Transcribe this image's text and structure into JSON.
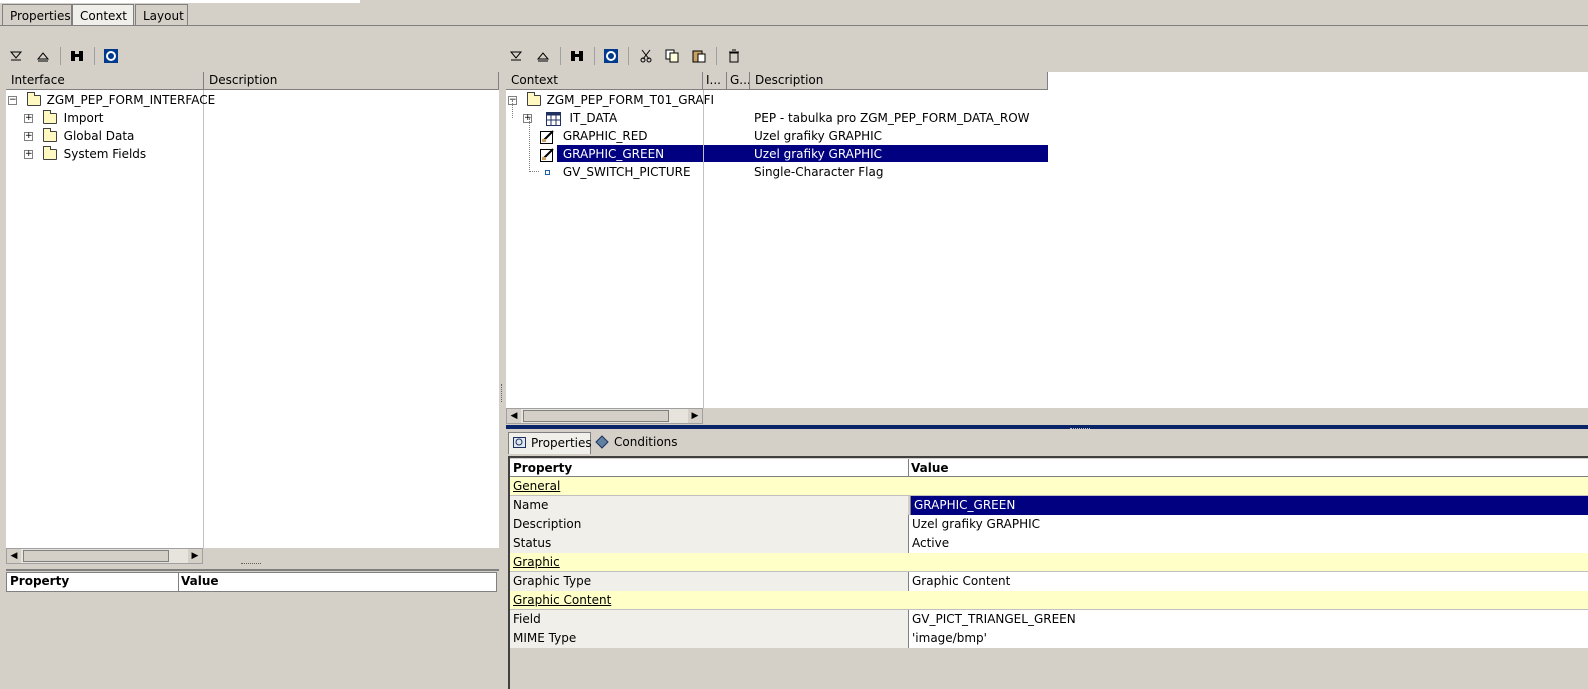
{
  "top_tabs": [
    {
      "label": "Properties",
      "active": false
    },
    {
      "label": "Context",
      "active": true
    },
    {
      "label": "Layout",
      "active": false
    }
  ],
  "left_toolbar": {
    "icons": [
      "expand-all-icon",
      "collapse-all-icon",
      "find-icon",
      "refresh-icon"
    ]
  },
  "right_toolbar": {
    "icons": [
      "expand-all-icon",
      "collapse-all-icon",
      "find-icon",
      "refresh-icon",
      "cut-icon",
      "copy-icon",
      "paste-icon",
      "delete-icon"
    ]
  },
  "interface_tree": {
    "headers": {
      "interface": "Interface",
      "description": "Description"
    },
    "root": "ZGM_PEP_FORM_INTERFACE",
    "children": [
      "Import",
      "Global Data",
      "System Fields"
    ]
  },
  "left_props": {
    "headers": {
      "property": "Property",
      "value": "Value"
    }
  },
  "context_tree": {
    "headers": {
      "context": "Context",
      "col2": "I...",
      "col3": "G...",
      "description": "Description"
    },
    "root": "ZGM_PEP_FORM_T01_GRAFI",
    "nodes": [
      {
        "name": "IT_DATA",
        "description": "PEP - tabulka pro  ZGM_PEP_FORM_DATA_ROW",
        "icon": "table-icon",
        "selected": false
      },
      {
        "name": "GRAPHIC_RED",
        "description": "Uzel grafiky GRAPHIC",
        "icon": "graphic-icon",
        "selected": false
      },
      {
        "name": "GRAPHIC_GREEN",
        "description": "Uzel grafiky GRAPHIC",
        "icon": "graphic-icon",
        "selected": true
      },
      {
        "name": "GV_SWITCH_PICTURE",
        "description": "Single-Character Flag",
        "icon": "field-icon",
        "selected": false
      }
    ]
  },
  "bottom_tabs": [
    {
      "label": "Properties",
      "icon": "properties-icon"
    },
    {
      "label": "Conditions",
      "icon": "conditions-icon"
    }
  ],
  "property_grid": {
    "headers": {
      "property": "Property",
      "value": "Value"
    },
    "rows": [
      {
        "category": "General"
      },
      {
        "property": "Name",
        "value": "GRAPHIC_GREEN",
        "selected": true
      },
      {
        "property": "Description",
        "value": "Uzel grafiky GRAPHIC"
      },
      {
        "property": "Status",
        "value": "Active"
      },
      {
        "category": "Graphic"
      },
      {
        "property": "Graphic Type",
        "value": "Graphic Content"
      },
      {
        "category": "Graphic Content"
      },
      {
        "property": "Field",
        "value": "GV_PICT_TRIANGEL_GREEN"
      },
      {
        "property": "MIME Type",
        "value": "'image/bmp'"
      }
    ]
  }
}
